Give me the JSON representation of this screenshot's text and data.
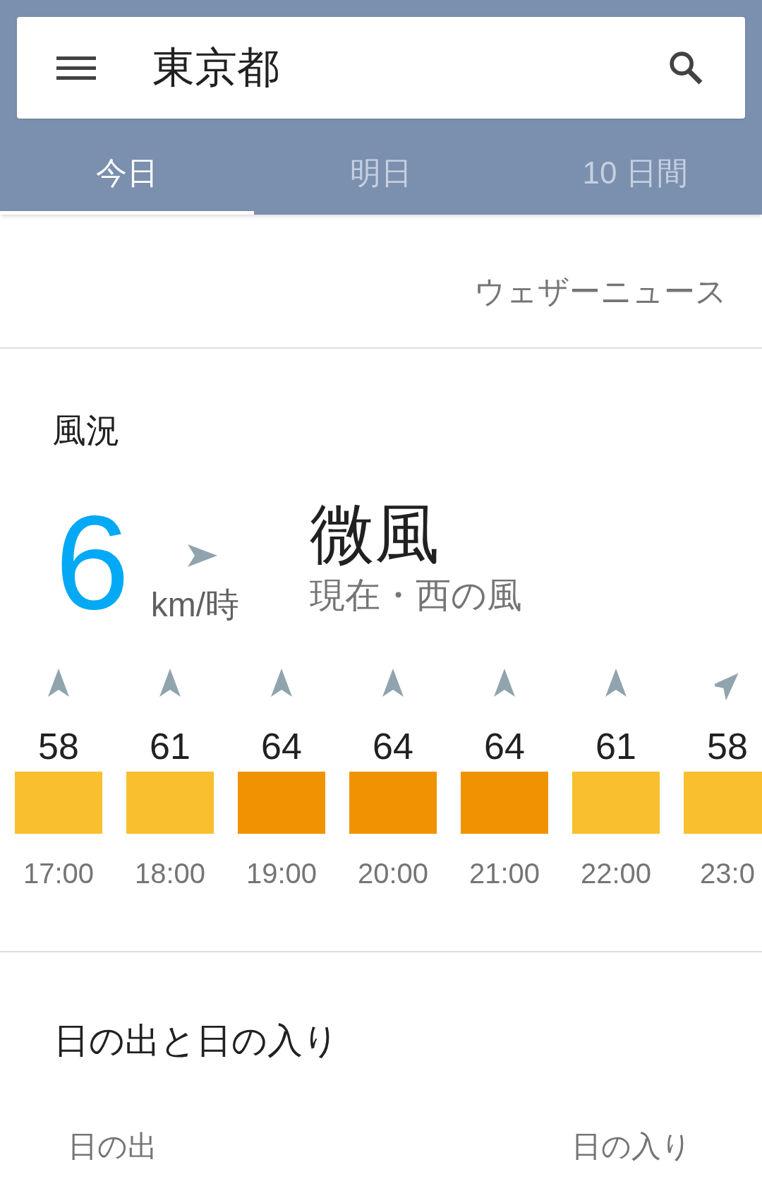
{
  "search": {
    "value": "東京都"
  },
  "tabs": [
    {
      "label": "今日",
      "selected": true
    },
    {
      "label": "明日",
      "selected": false
    },
    {
      "label": "10 日間",
      "selected": false
    }
  ],
  "source": "ウェザーニュース",
  "wind": {
    "title": "風況",
    "speed": "6",
    "unit": "km/時",
    "description": "微風",
    "detail": "現在・西の風",
    "hours": [
      {
        "kind": "up",
        "value": "58",
        "color": "#f9bf2f",
        "time": "17:00"
      },
      {
        "kind": "up",
        "value": "61",
        "color": "#f9bf2f",
        "time": "18:00"
      },
      {
        "kind": "up",
        "value": "64",
        "color": "#f09302",
        "time": "19:00"
      },
      {
        "kind": "up",
        "value": "64",
        "color": "#f09302",
        "time": "20:00"
      },
      {
        "kind": "up",
        "value": "64",
        "color": "#f09302",
        "time": "21:00"
      },
      {
        "kind": "up",
        "value": "61",
        "color": "#f9bf2f",
        "time": "22:00"
      },
      {
        "kind": "up-right",
        "value": "58",
        "color": "#f9bf2f",
        "time": "23:0"
      }
    ]
  },
  "sun": {
    "title": "日の出と日の入り",
    "sunrise_label": "日の出",
    "sunset_label": "日の入り"
  }
}
